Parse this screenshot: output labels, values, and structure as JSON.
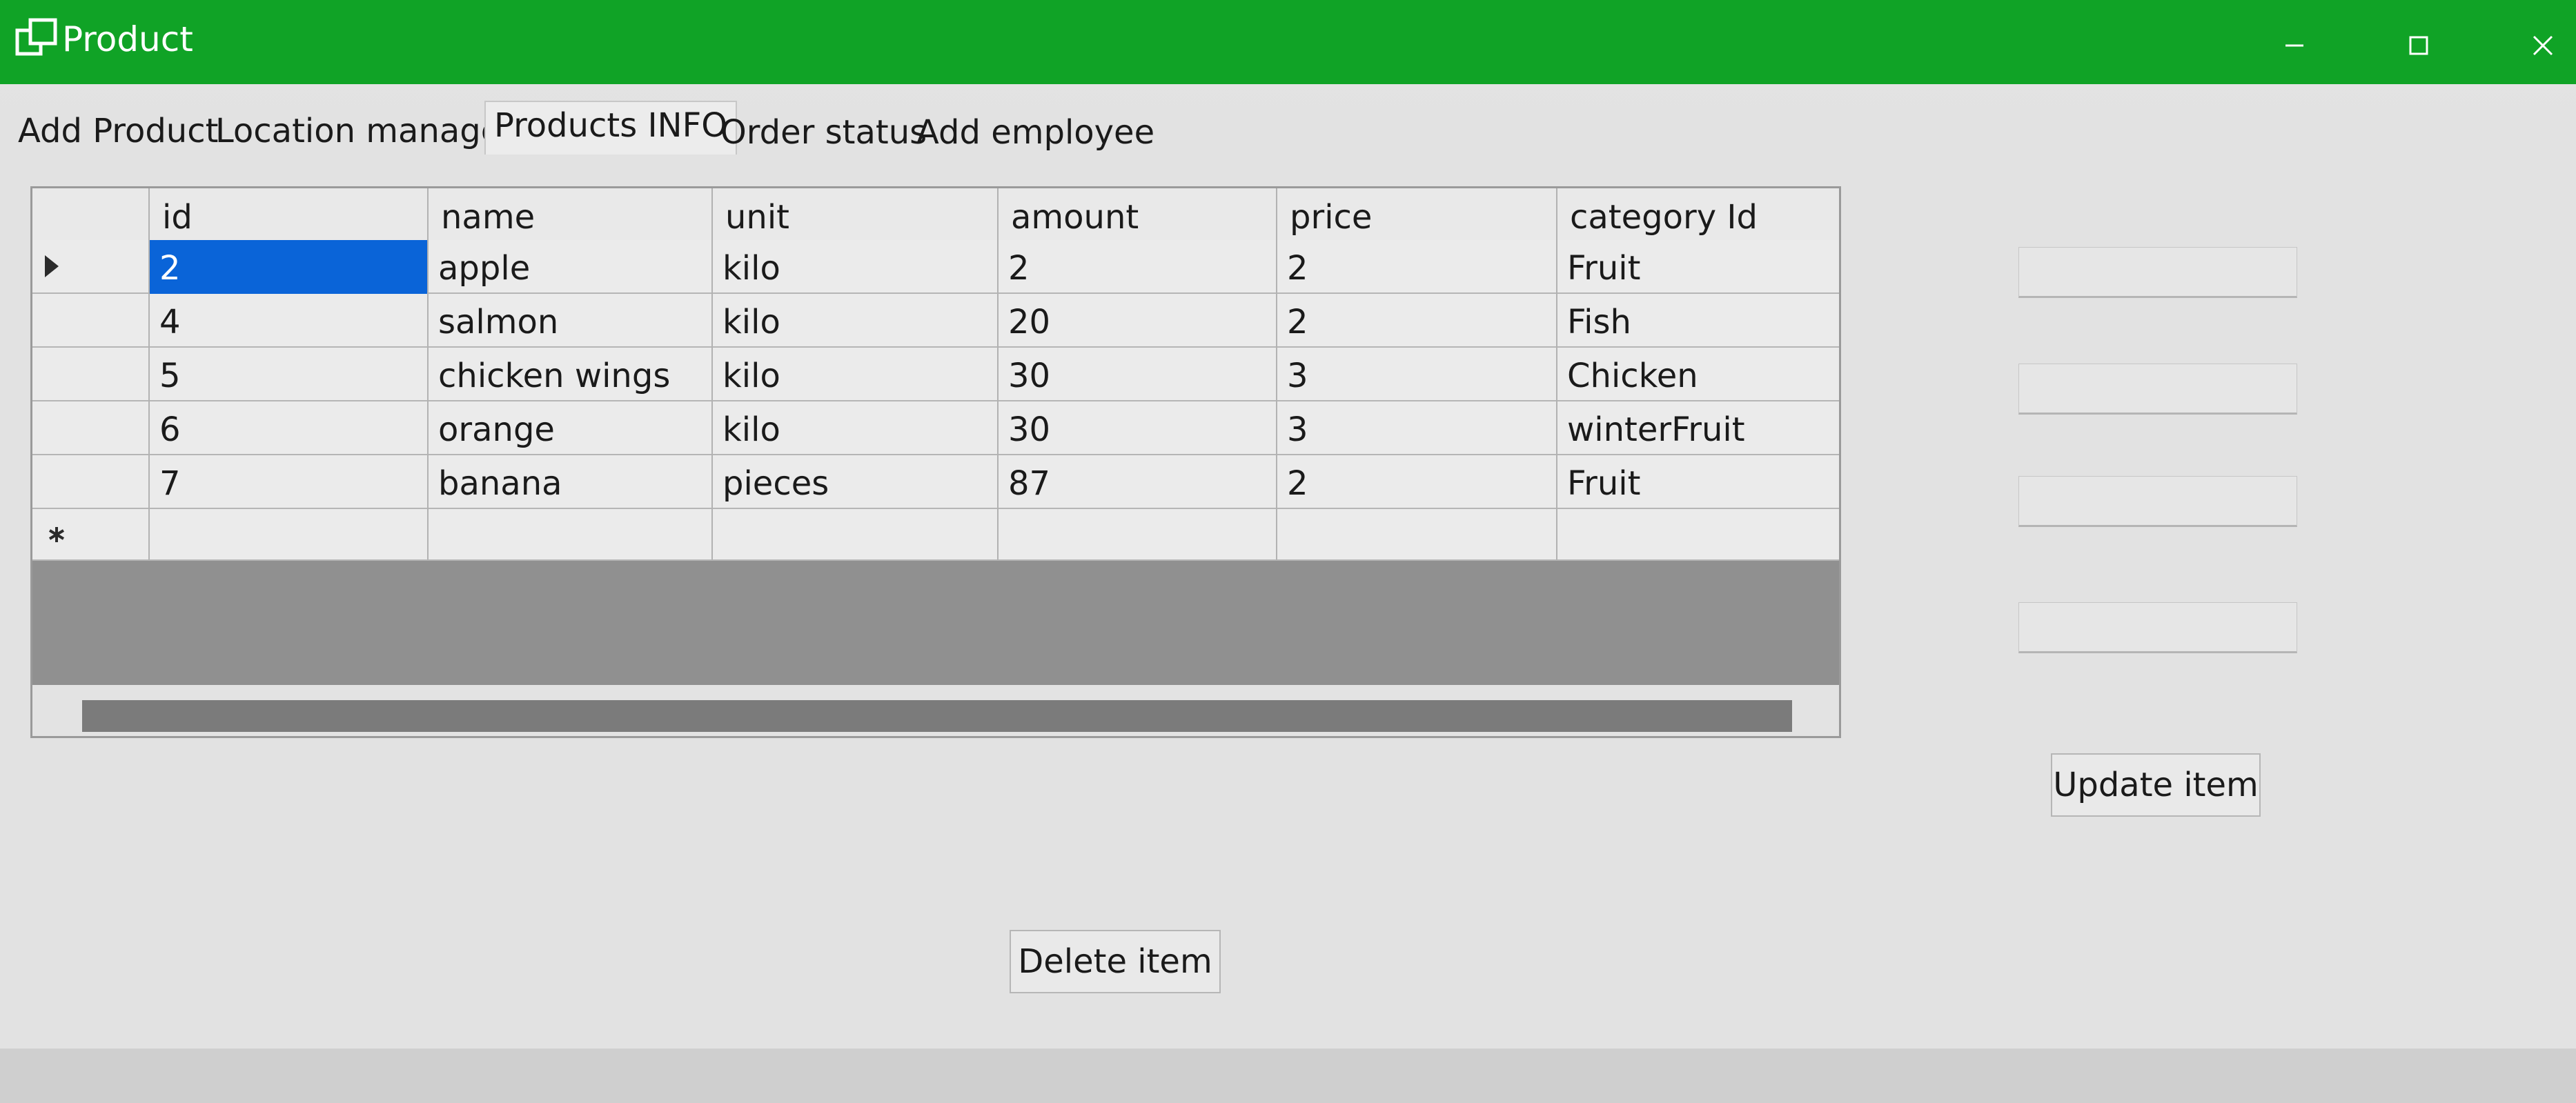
{
  "window": {
    "title": "Product",
    "icon": "window-app-icon",
    "controls": {
      "minimize_icon": "minimize-icon",
      "maximize_icon": "maximize-icon",
      "close_icon": "close-icon"
    },
    "title_bar_color": "#10a326"
  },
  "tabs": [
    {
      "label": "Add Product",
      "active": false
    },
    {
      "label": "Location manager",
      "active": false
    },
    {
      "label": "Products INFO",
      "active": true
    },
    {
      "label": "Order status",
      "active": false
    },
    {
      "label": "Add employee",
      "active": false
    }
  ],
  "grid": {
    "columns": [
      "id",
      "name",
      "unit",
      "amount",
      "price",
      "category Id"
    ],
    "rows": [
      [
        "2",
        "apple",
        "kilo",
        "2",
        "2",
        "Fruit"
      ],
      [
        "4",
        "salmon",
        "kilo",
        "20",
        "2",
        "Fish"
      ],
      [
        "5",
        "chicken wings",
        "kilo",
        "30",
        "3",
        "Chicken"
      ],
      [
        "6",
        "orange",
        "kilo",
        "30",
        "3",
        "winterFruit"
      ],
      [
        "7",
        "banana",
        "pieces",
        "87",
        "2",
        "Fruit"
      ]
    ],
    "current_row_indicator_icon": "current-row-arrow-icon",
    "new_row_indicator_icon": "new-row-asterisk-icon",
    "selection_color": "#0a64d8"
  },
  "fields": [
    {
      "value": ""
    },
    {
      "value": ""
    },
    {
      "value": ""
    },
    {
      "value": ""
    }
  ],
  "buttons": {
    "update": "Update item",
    "delete": "Delete item"
  }
}
